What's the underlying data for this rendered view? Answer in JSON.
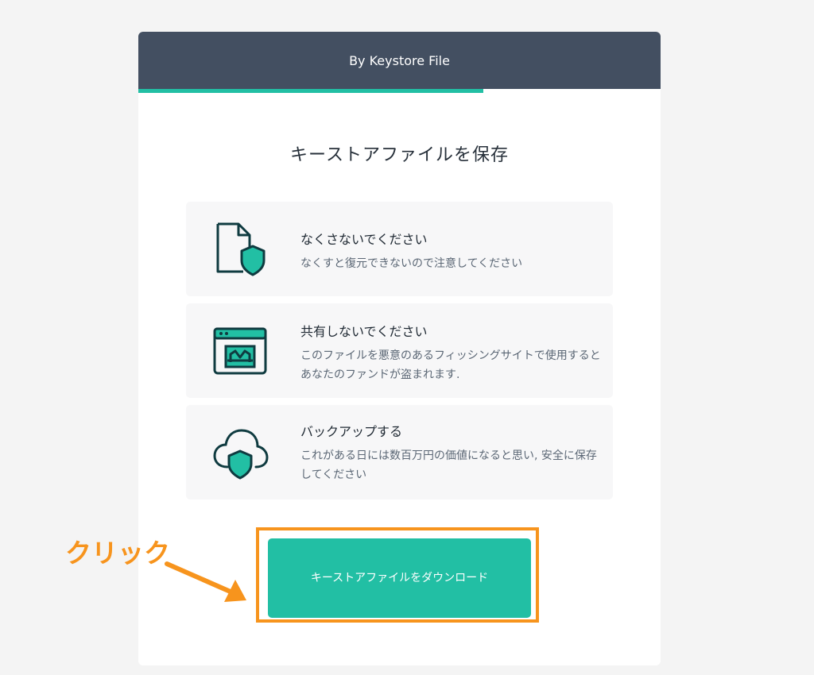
{
  "header": {
    "title": "By Keystore File"
  },
  "progress": {
    "fraction": 0.66
  },
  "page": {
    "title": "キーストアファイルを保存"
  },
  "notes": [
    {
      "icon": "file-shield-icon",
      "title": "なくさないでください",
      "desc": "なくすと復元できないので注意してください"
    },
    {
      "icon": "phishing-window-icon",
      "title": "共有しないでください",
      "desc": "このファイルを悪意のあるフィッシングサイトで使用するとあなたのファンドが盗まれます."
    },
    {
      "icon": "cloud-shield-icon",
      "title": "バックアップする",
      "desc": "これがある日には数百万円の価値になると思い, 安全に保存してください"
    }
  ],
  "download_button": {
    "label": "キーストアファイルをダウンロード"
  },
  "annotation": {
    "label": "クリック"
  },
  "colors": {
    "accent": "#22bfa4",
    "header": "#434f61",
    "annotation": "#f7941d",
    "icon": "#0f3b40"
  }
}
